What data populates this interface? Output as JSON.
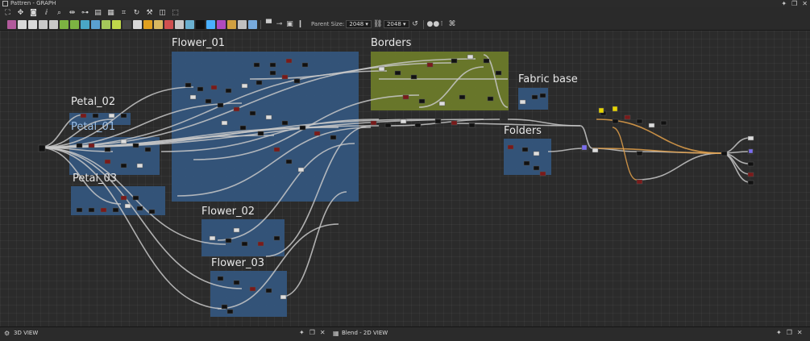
{
  "window": {
    "title": "Pattren - GRAPH"
  },
  "toolbar": {
    "parent_size_label": "Parent Size:",
    "parent_size_width": "2048",
    "parent_size_height": "2048",
    "swatch_colors": [
      "#b25a9c",
      "#d9d9d9",
      "#d9d9d9",
      "#c8c8c8",
      "#c8c8c8",
      "#7cb342",
      "#7cb342",
      "#49a7c6",
      "#5aa0d0",
      "#a5c85a",
      "#c0d84a",
      "#444",
      "#d8d8d8",
      "#e0a020",
      "#d8b860",
      "#d05050",
      "#c8c8c8",
      "#6ab0d0",
      "#111",
      "#4ab0ff",
      "#b04ac0",
      "#d0a040",
      "#c0c0c0",
      "#7ad"
    ]
  },
  "frames": [
    {
      "id": "flower-01",
      "label": "Flower_01",
      "color": "#34557c"
    },
    {
      "id": "borders",
      "label": "Borders",
      "color": "#6b7a2a"
    },
    {
      "id": "fabric-base",
      "label": "Fabric base",
      "color": "#34557c"
    },
    {
      "id": "petal-02",
      "label": "Petal_02",
      "color": "#34557c"
    },
    {
      "id": "petal-01",
      "label": "Petal_01",
      "color": "#34557c"
    },
    {
      "id": "petal-03",
      "label": "Petal_03",
      "color": "#34557c"
    },
    {
      "id": "folders",
      "label": "Folders",
      "color": "#34557c"
    },
    {
      "id": "flower-02",
      "label": "Flower_02",
      "color": "#34557c"
    },
    {
      "id": "flower-03",
      "label": "Flower_03",
      "color": "#34557c"
    }
  ],
  "panels": {
    "view3d": {
      "title": "3D VIEW"
    },
    "view2d": {
      "title": "Blend - 2D VIEW"
    }
  },
  "icons": {
    "pin": "pin-icon",
    "restore": "restore-icon",
    "close": "close-icon"
  }
}
